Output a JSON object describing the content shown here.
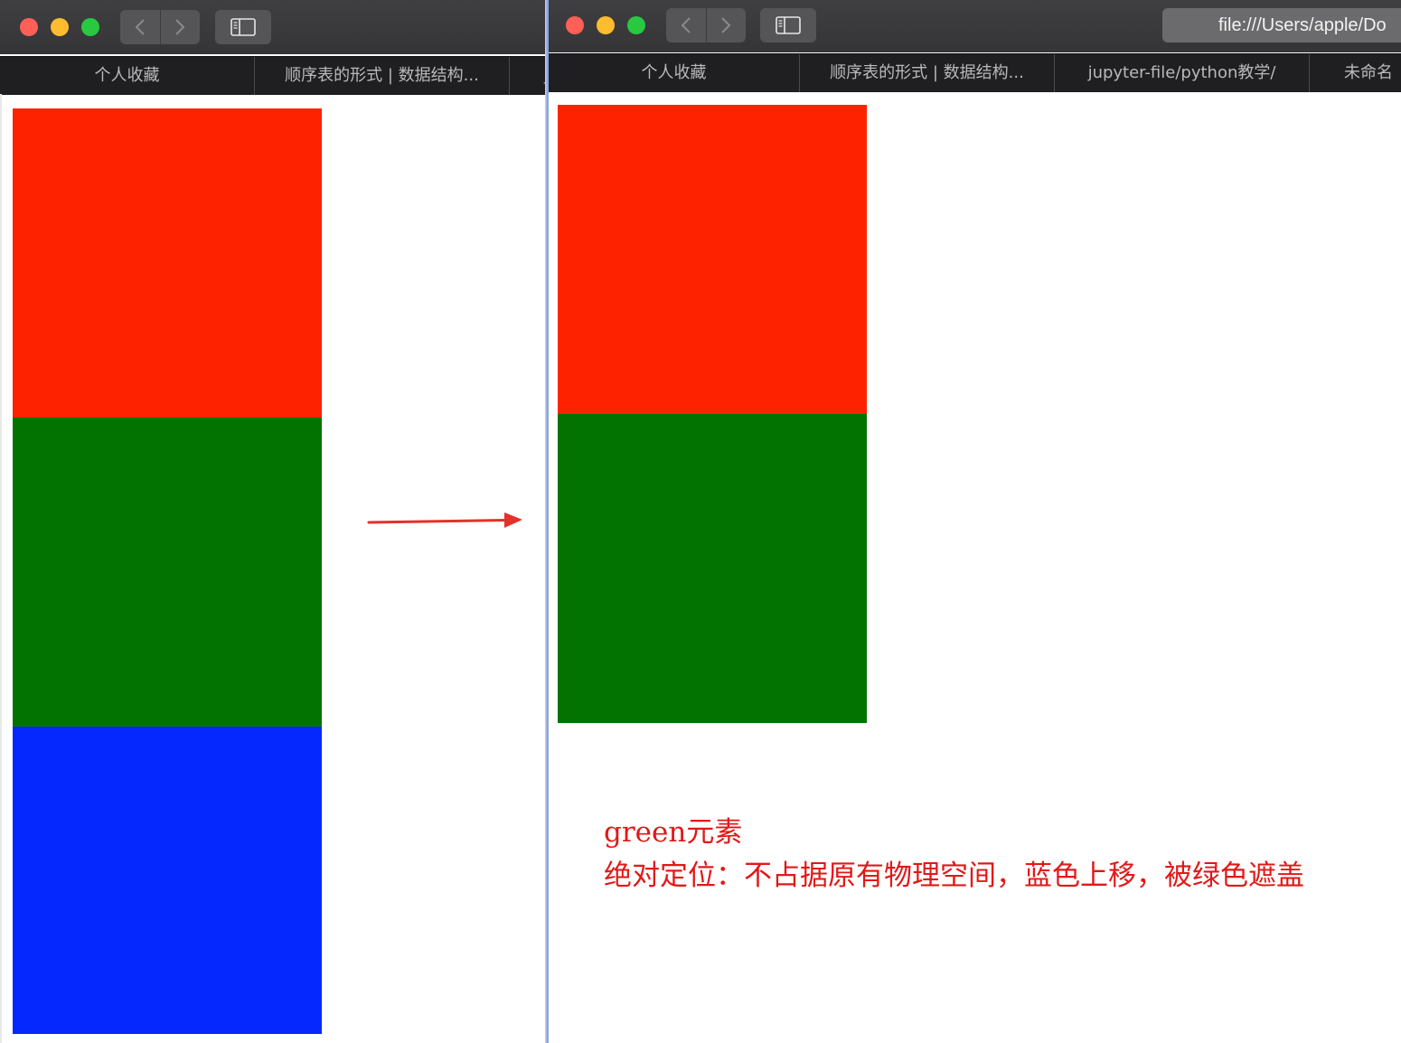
{
  "left_window": {
    "tabs": [
      {
        "label": "个人收藏"
      },
      {
        "label": "顺序表的形式 | 数据结构..."
      },
      {
        "label": "j"
      }
    ]
  },
  "right_window": {
    "address": "file:///Users/apple/Do",
    "tabs": [
      {
        "label": "个人收藏"
      },
      {
        "label": "顺序表的形式 | 数据结构..."
      },
      {
        "label": "jupyter-file/python教学/"
      },
      {
        "label": "未命名"
      }
    ]
  },
  "annotation": {
    "line1": "green元素",
    "line2": "绝对定位：不占据原有物理空间，蓝色上移，被绿色遮盖"
  },
  "colors": {
    "red": "#ff2200",
    "green": "#027301",
    "blue": "#0428ff",
    "arrow": "#e4312b",
    "note": "#e21818"
  },
  "icons": {
    "back": "chevron-left-icon",
    "forward": "chevron-right-icon",
    "sidebar": "sidebar-icon",
    "arrow": "arrow-right-icon"
  }
}
